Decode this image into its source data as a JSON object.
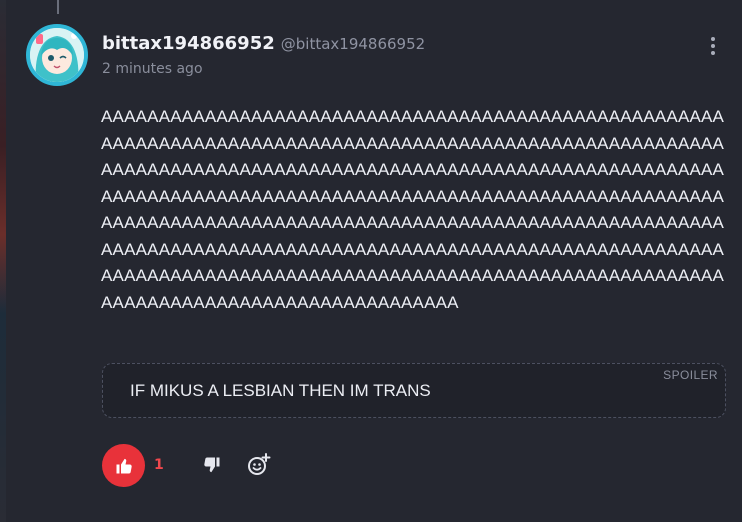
{
  "post": {
    "username": "bittax194866952",
    "handle": "@bittax194866952",
    "timestamp": "2 minutes ago",
    "body": "AAAAAAAAAAAAAAAAAAAAAAAAAAAAAAAAAAAAAAAAAAAAAAAAAAAAAAAAAAAAAAAAAAAAAAAAAAAAAAAAAAAAAAAAAAAAAAAAAAAAAAAAAAAAAAAAAAAAAAAAAAAAAAAAAAAAAAAAAAAAAAAAAAAAAAAAAAAAAAAAAAAAAAAAAAAAAAAAAAAAAAAAAAAAAAAAAAAAAAAAAAAAAAAAAAAAAAAAAAAAAAAAAAAAAAAAAAAAAAAAAAAAAAAAAAAAAAAAAAAAAAAAAAAAAAAAAAAAAAAAAAAAAAAAAAAAAAAAAAAAAAAAAAAAAAAAAAAAAAAAAAAAAAAAAAAAAAAAAAAAAAAAAAAAAAAAAAAAAAAAAAAAAAAAAAAAAAAAAAAAAAAAAAAAAAAAAAAAAAAAAAAAAAAAA",
    "spoiler": {
      "tag": "SPOILER",
      "text": "IF MIKUS A LESBIAN THEN IM TRANS"
    },
    "reactions": {
      "like_count": "1",
      "like_icon": "thumbs-up-icon",
      "dislike_icon": "thumbs-down-icon",
      "react_icon": "add-emoji-icon"
    }
  },
  "colors": {
    "background": "#252730",
    "accent": "#e8323a",
    "avatar_ring": "#2fb6d6"
  }
}
